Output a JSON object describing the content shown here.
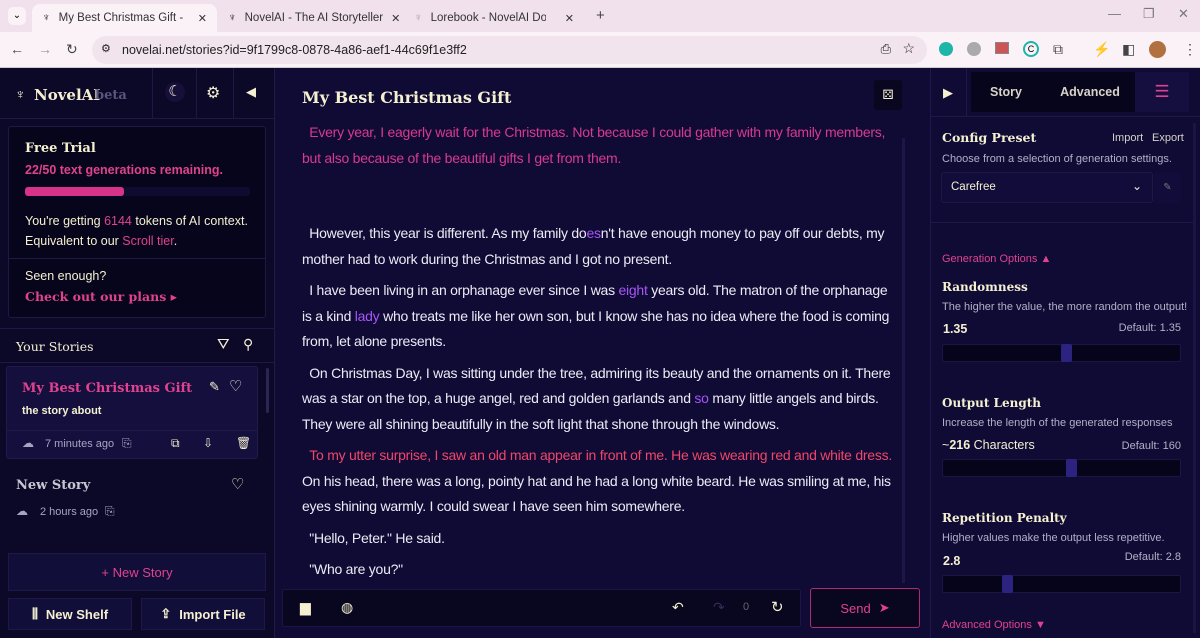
{
  "browser": {
    "tabs": [
      {
        "title": "My Best Christmas Gift - NovelAI",
        "active": true
      },
      {
        "title": "NovelAI - The AI Storyteller"
      },
      {
        "title": "Lorebook - NovelAI Documentation"
      }
    ],
    "url": "novelai.net/stories?id=9f1799c8-0878-4a86-aef1-44c69f1e3ff2"
  },
  "sidebar": {
    "brand": "NovelAI",
    "brand_tag": "beta",
    "trial": {
      "title": "Free Trial",
      "remaining": "22/50 text generations remaining.",
      "progress": 0.44,
      "context_pre": "You're getting ",
      "tokens": "6144",
      "context_post": " tokens of AI context.",
      "equiv_pre": "Equivalent to our ",
      "tier": "Scroll tier",
      "equiv_post": ".",
      "seen": "Seen enough?",
      "plans": "Check out our plans"
    },
    "stories_header": "Your Stories",
    "stories": [
      {
        "title": "My Best Christmas Gift",
        "desc": "the story about",
        "time": "7 minutes ago",
        "selected": true
      },
      {
        "title": "New Story",
        "time": "2 hours ago"
      }
    ],
    "new_story": "+ New Story",
    "new_shelf": "New Shelf",
    "import_file": "Import File"
  },
  "editor": {
    "title": "My Best Christmas Gift",
    "paragraphs": [
      [
        {
          "t": "Every year, I eagerly wait for the Christmas. Not because I could gather with my family members, but also because of the beautiful gifts I get from them.",
          "c": "pink"
        }
      ],
      [],
      [
        {
          "t": "However, this year is different. As my family do"
        },
        {
          "t": "es",
          "c": "purple"
        },
        {
          "t": "n't have enough money to pay off our debts, my mother had to work during the Christmas and I got no present."
        }
      ],
      [
        {
          "t": "I have been living in an orphanage ever since I was "
        },
        {
          "t": "eight",
          "c": "purple"
        },
        {
          "t": "  years old. The matron of the orphanage is a kind "
        },
        {
          "t": "lady",
          "c": "purple"
        },
        {
          "t": " who treats me like her own son, but I know she has no idea where the food is coming from, let alone presents."
        }
      ],
      [
        {
          "t": "On Christmas Day, I was sitting under the tree, admiring its beauty and the ornaments on it. There was a star on the top, a huge angel, red and golden garlands and "
        },
        {
          "t": "so",
          "c": "purple"
        },
        {
          "t": " many little angels and birds. They were all shining beautifully in the soft light that shone through the windows."
        }
      ],
      [
        {
          "t": "To my utter surprise, I saw an old man appear in front of me. He was wearing red and white dress.",
          "c": "red"
        },
        {
          "t": " On his head, there was a long, pointy hat and he had a long white beard. He was smiling at me, his eyes shining warmly. I could swear I have seen him somewhere."
        }
      ],
      [
        {
          "t": "\"Hello, Peter.\" He said."
        }
      ],
      [
        {
          "t": "\"Who are you?\""
        }
      ]
    ],
    "redo_count": "0",
    "send": "Send"
  },
  "settings": {
    "tabs": [
      "Story",
      "Advanced"
    ],
    "preset_title": "Config Preset",
    "import": "Import",
    "export": "Export",
    "preset_desc": "Choose from a selection of generation settings.",
    "preset_value": "Carefree",
    "gen_options": "Generation Options",
    "randomness": {
      "title": "Randomness",
      "desc": "The higher the value, the more random the output!",
      "value": "1.35",
      "default": "Default: 1.35",
      "fraction": 0.52
    },
    "output_length": {
      "title": "Output Length",
      "desc": "Increase the length of the generated responses",
      "prefix": "~",
      "value": "216",
      "unit": " Characters",
      "default": "Default: 160",
      "fraction": 0.54
    },
    "repetition": {
      "title": "Repetition Penalty",
      "desc": "Higher values make the output less repetitive.",
      "value": "2.8",
      "default": "Default: 2.8",
      "fraction": 0.27
    },
    "advanced_options": "Advanced Options"
  },
  "colors": {
    "accent": "#e0428f",
    "bg": "#0f0b35",
    "cream": "#f5f0d0"
  }
}
